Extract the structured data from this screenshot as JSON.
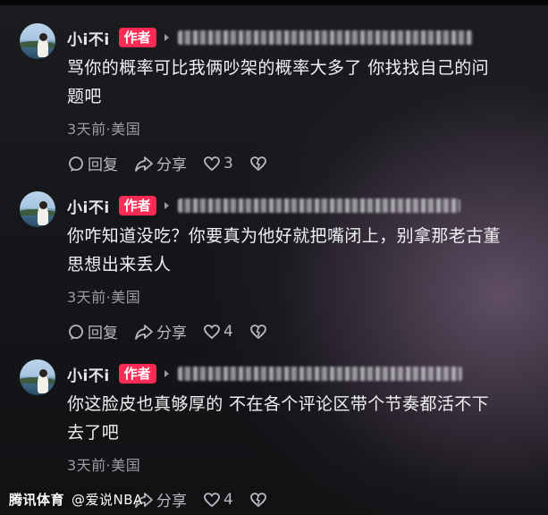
{
  "comments": [
    {
      "username": "小i不i",
      "badge": "作者",
      "content_line1": "骂你的概率可比我俩吵架的概率大多了 你找找自己的问",
      "content_line2": "题吧",
      "meta": "3天前·美国",
      "reply_label": "回复",
      "share_label": "分享",
      "like_count": "3"
    },
    {
      "username": "小i不i",
      "badge": "作者",
      "content_line1": "你咋知道没吃？你要真为他好就把嘴闭上，别拿那老古董",
      "content_line2": "思想出来丢人",
      "meta": "3天前·美国",
      "reply_label": "回复",
      "share_label": "分享",
      "like_count": "4"
    },
    {
      "username": "小i不i",
      "badge": "作者",
      "content_line1": "你这脸皮也真够厚的 不在各个评论区带个节奏都活不下",
      "content_line2": "去了吧",
      "meta": "3天前·美国",
      "reply_label": "回复",
      "share_label": "分享",
      "like_count": "4"
    }
  ],
  "watermark": {
    "source": "腾讯体育",
    "handle": "@爱说NBA"
  },
  "colors": {
    "author_badge": "#fe2c55",
    "text_primary": "#f1f1f3",
    "text_secondary": "#9c9ca2"
  },
  "icons": [
    "reply-icon",
    "share-icon",
    "like-heart-icon",
    "dislike-heart-icon"
  ]
}
